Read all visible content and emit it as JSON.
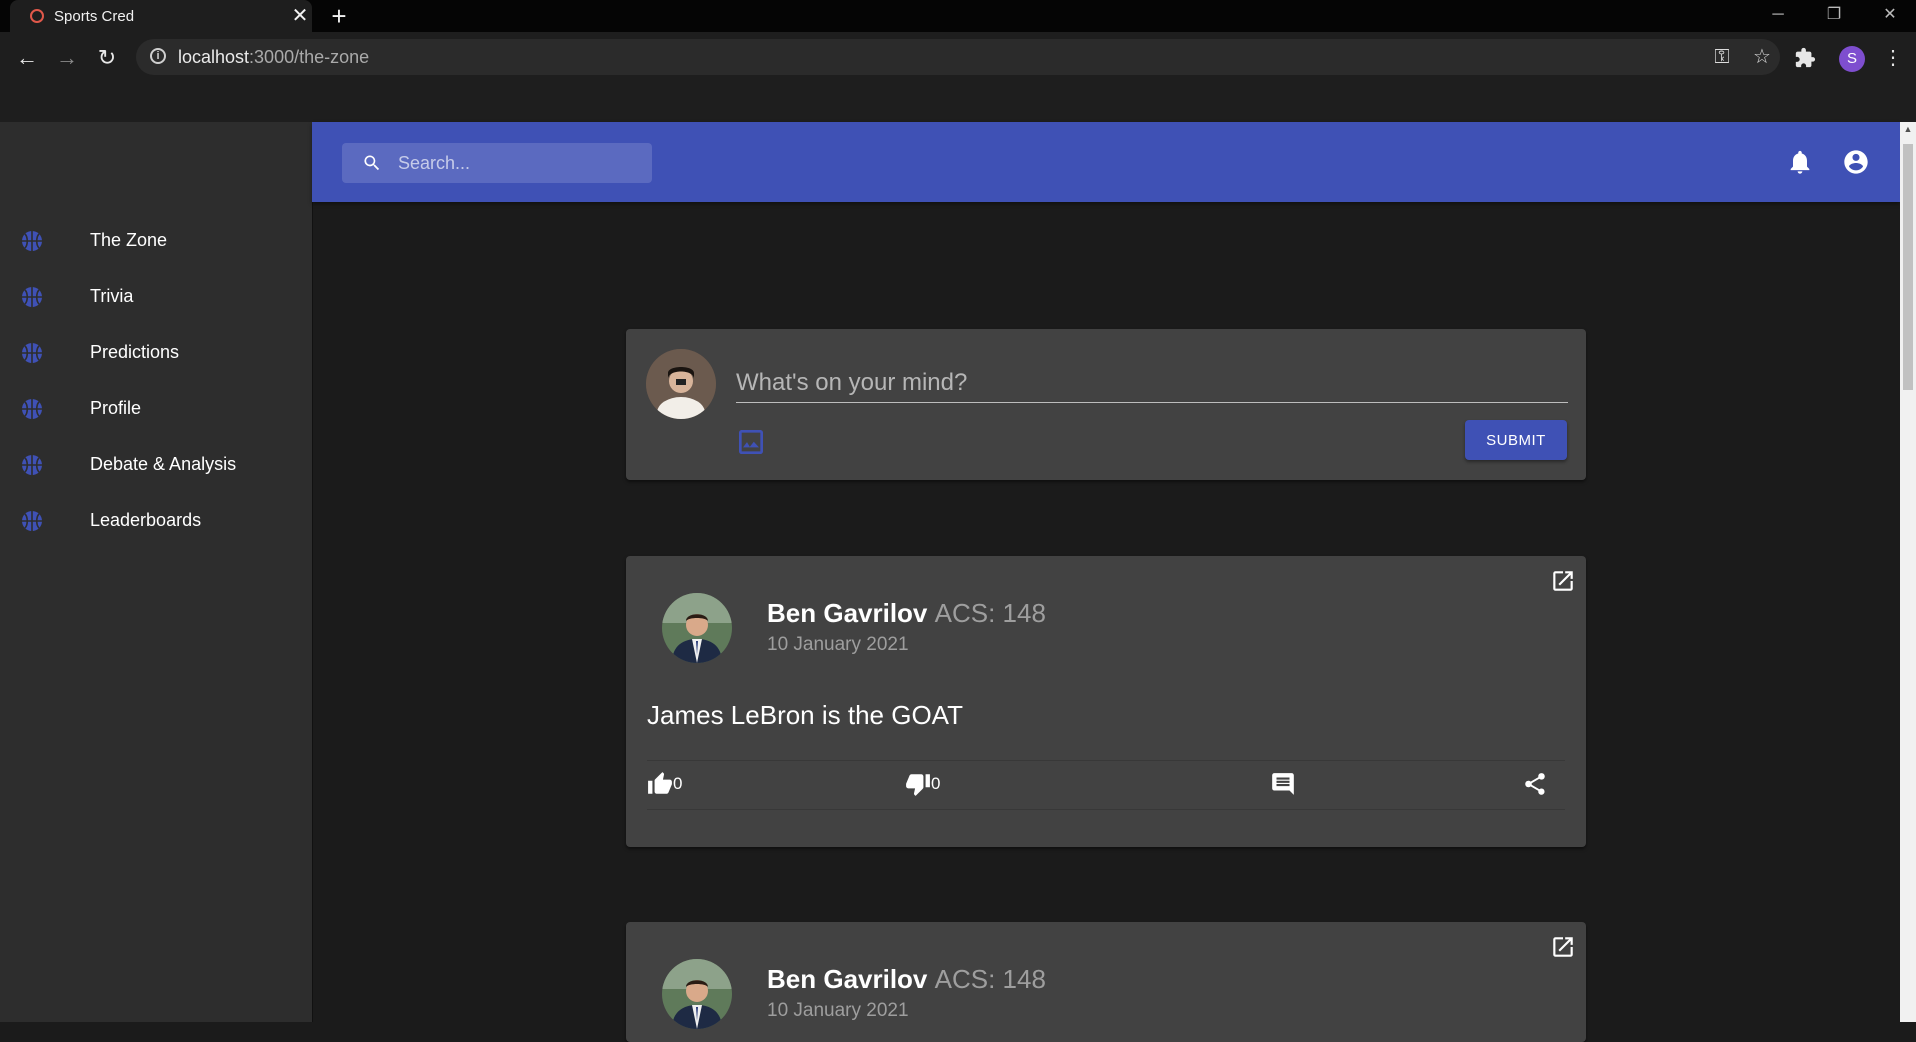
{
  "browser": {
    "tab_title": "Sports Cred",
    "url_host": "localhost",
    "url_path": ":3000/the-zone",
    "profile_initial": "S"
  },
  "search": {
    "placeholder": "Search..."
  },
  "sidebar": {
    "items": [
      {
        "label": "The Zone",
        "icon": "basketball-icon"
      },
      {
        "label": "Trivia",
        "icon": "basketball-icon"
      },
      {
        "label": "Predictions",
        "icon": "basketball-icon"
      },
      {
        "label": "Profile",
        "icon": "basketball-icon"
      },
      {
        "label": "Debate & Analysis",
        "icon": "basketball-icon"
      },
      {
        "label": "Leaderboards",
        "icon": "basketball-icon"
      }
    ]
  },
  "composer": {
    "placeholder": "What's on your mind?",
    "submit_label": "SUBMIT"
  },
  "posts": [
    {
      "author": "Ben Gavrilov",
      "acs": "ACS: 148",
      "date": "10 January 2021",
      "body": "James LeBron is the GOAT",
      "likes": "0",
      "dislikes": "0"
    },
    {
      "author": "Ben Gavrilov",
      "acs": "ACS: 148",
      "date": "10 January 2021"
    }
  ],
  "colors": {
    "primary": "#3f51b5",
    "sidebar": "#2d2d2d",
    "card": "#424242",
    "background": "#1b1b1b"
  }
}
